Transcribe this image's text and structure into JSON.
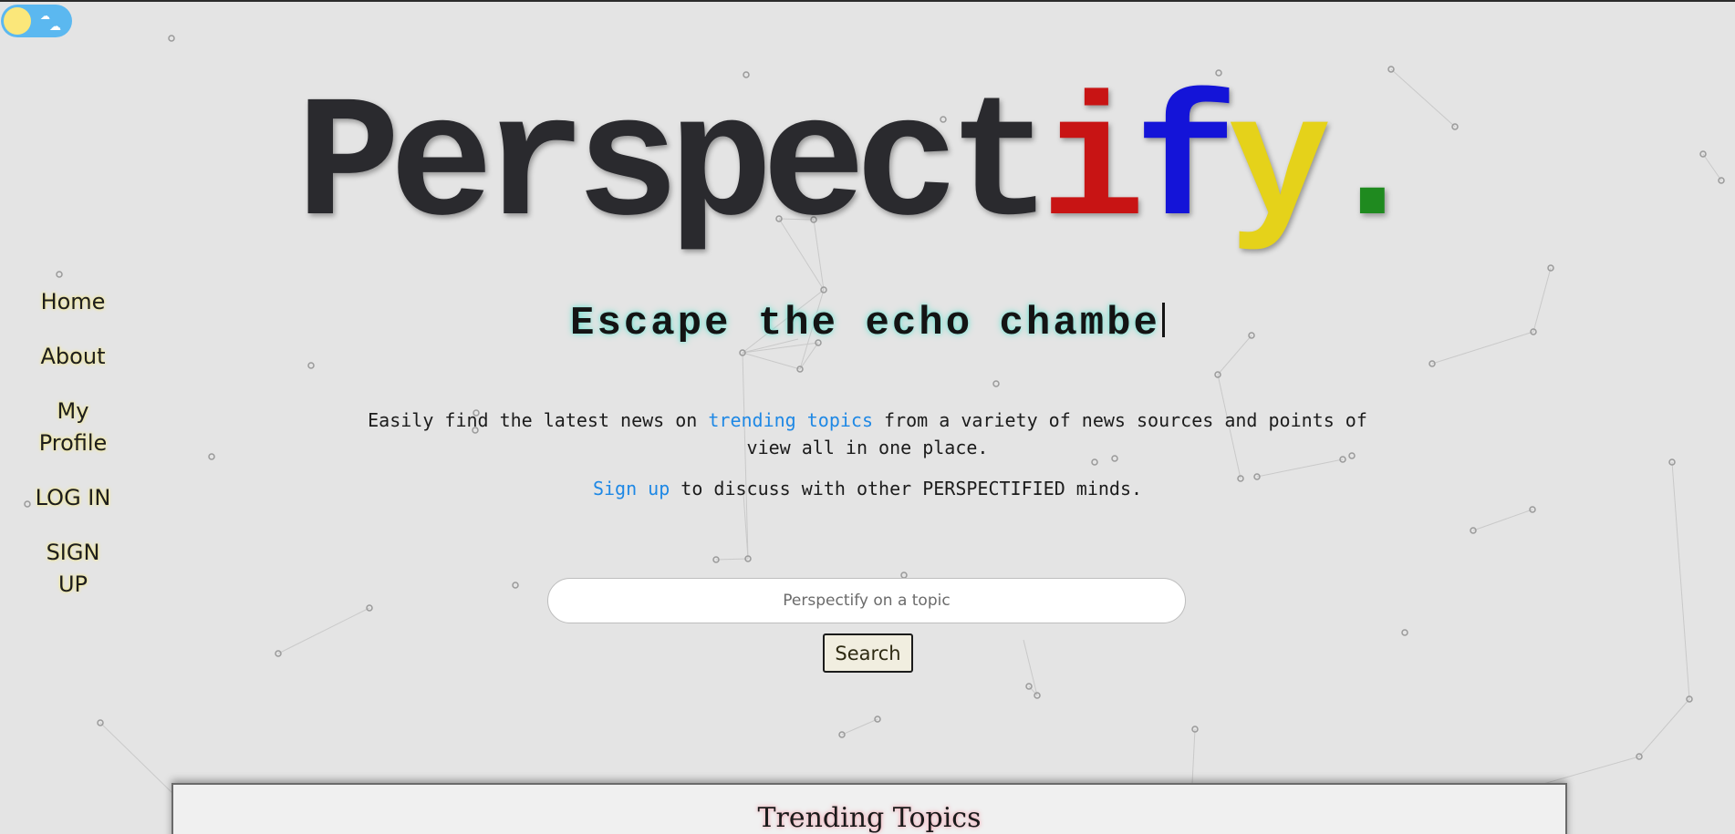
{
  "brand": {
    "logo_letters": [
      "P",
      "e",
      "r",
      "s",
      "p",
      "e",
      "c",
      "t",
      "i",
      "f",
      "y",
      "."
    ],
    "logo_colors": [
      "#2a2a2e",
      "#2a2a2e",
      "#2a2a2e",
      "#2a2a2e",
      "#2a2a2e",
      "#2a2a2e",
      "#2a2a2e",
      "#2a2a2e",
      "#c81414",
      "#1414d8",
      "#e5d21a",
      "#1f8a1f"
    ]
  },
  "theme_toggle": {
    "state": "light",
    "icons": [
      "sun-icon",
      "cloud-icon"
    ]
  },
  "nav": {
    "home": "Home",
    "about": "About",
    "my_profile_line1": "My",
    "my_profile_line2": "Profile",
    "log_in": "LOG IN",
    "sign_up_line1": "SIGN",
    "sign_up_line2": "UP"
  },
  "hero": {
    "tagline": "Escape the echo chambe",
    "intro_before": "Easily find the latest news on ",
    "intro_link": "trending topics",
    "intro_after": " from a variety of news sources and points of view all in one place.",
    "signup_link": "Sign up",
    "signup_after": " to discuss with other PERSPECTIFIED minds."
  },
  "search": {
    "placeholder": "Perspectify on a topic",
    "value": "",
    "button_label": "Search"
  },
  "trending": {
    "title": "Trending Topics"
  },
  "colors": {
    "background": "#e4e4e4",
    "link": "#1e88e5",
    "nav_glow": "#f5ea8a",
    "tagline_glow": "#6ee0d0"
  }
}
